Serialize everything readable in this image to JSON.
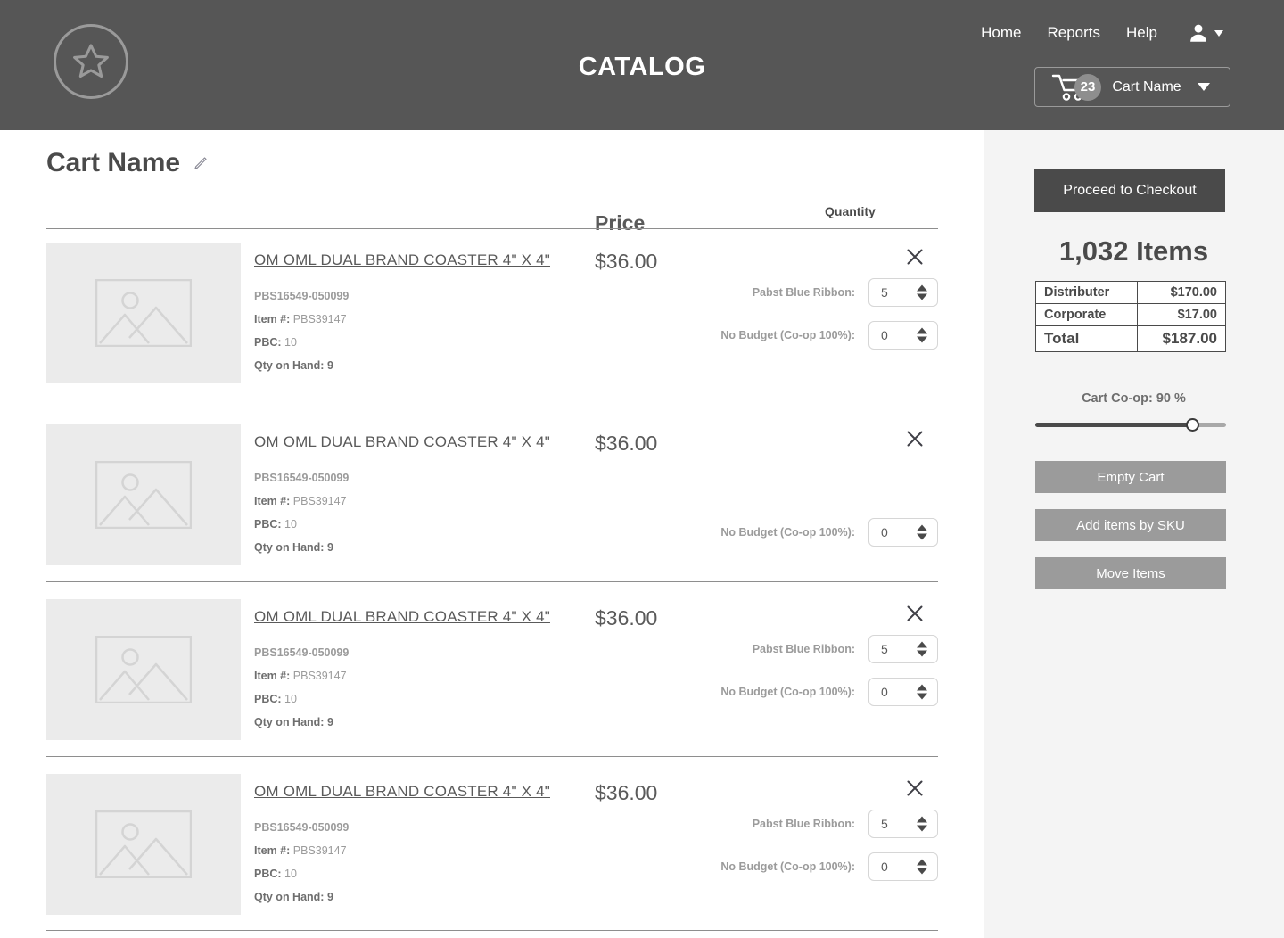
{
  "header": {
    "logo_icon": "star-in-circle-icon",
    "title": "CATALOG",
    "nav": [
      {
        "label": "Home"
      },
      {
        "label": "Reports"
      },
      {
        "label": "Help"
      }
    ],
    "user_icon": "user-account-icon",
    "user_caret_icon": "chevron-down-icon",
    "cart": {
      "cart_icon": "shopping-cart-icon",
      "badge": "23",
      "label": "Cart Name",
      "caret_icon": "chevron-down-icon"
    }
  },
  "main": {
    "cart_name": "Cart Name",
    "edit_icon": "pencil-edit-icon",
    "columns": {
      "price": "Price",
      "quantity": "Quantity"
    },
    "rows": [
      {
        "thumb_icon": "image-placeholder-icon",
        "title": "OM OML DUAL BRAND COASTER 4\" X 4\"",
        "sku": "PBS16549-050099",
        "item_label": "Item #:",
        "item_value": "PBS39147",
        "pbc_label": "PBC:",
        "pbc_value": "10",
        "qty_label": "Qty on Hand:",
        "qty_value": "9",
        "price": "$36.00",
        "remove_icon": "close-x-icon",
        "budgets": [
          {
            "label": "Pabst Blue Ribbon:",
            "value": "5"
          },
          {
            "label": "No Budget (Co-op 100%):",
            "value": "0"
          }
        ]
      },
      {
        "thumb_icon": "image-placeholder-icon",
        "title": "OM OML DUAL BRAND COASTER 4\" X 4\"",
        "sku": "PBS16549-050099",
        "item_label": "Item #:",
        "item_value": "PBS39147",
        "pbc_label": "PBC:",
        "pbc_value": "10",
        "qty_label": "Qty on Hand:",
        "qty_value": "9",
        "price": "$36.00",
        "remove_icon": "close-x-icon",
        "budgets": [
          {
            "label": "No Budget (Co-op 100%):",
            "value": "0"
          }
        ]
      },
      {
        "thumb_icon": "image-placeholder-icon",
        "title": "OM OML DUAL BRAND COASTER 4\" X 4\"",
        "sku": "PBS16549-050099",
        "item_label": "Item #:",
        "item_value": "PBS39147",
        "pbc_label": "PBC:",
        "pbc_value": "10",
        "qty_label": "Qty on Hand:",
        "qty_value": "9",
        "price": "$36.00",
        "remove_icon": "close-x-icon",
        "budgets": [
          {
            "label": "Pabst Blue Ribbon:",
            "value": "5"
          },
          {
            "label": "No Budget (Co-op 100%):",
            "value": "0"
          }
        ]
      },
      {
        "thumb_icon": "image-placeholder-icon",
        "title": "OM OML DUAL BRAND COASTER 4\" X 4\"",
        "sku": "PBS16549-050099",
        "item_label": "Item #:",
        "item_value": "PBS39147",
        "pbc_label": "PBC:",
        "pbc_value": "10",
        "qty_label": "Qty on Hand:",
        "qty_value": "9",
        "price": "$36.00",
        "remove_icon": "close-x-icon",
        "budgets": [
          {
            "label": "Pabst Blue Ribbon:",
            "value": "5"
          },
          {
            "label": "No Budget (Co-op 100%):",
            "value": "0"
          }
        ]
      }
    ]
  },
  "sidebar": {
    "checkout_label": "Proceed to Checkout",
    "items_count": "1,032 Items",
    "totals": [
      {
        "label": "Distributer",
        "value": "$170.00"
      },
      {
        "label": "Corporate",
        "value": "$17.00"
      },
      {
        "label": "Total",
        "value": "$187.00"
      }
    ],
    "coop_label": "Cart Co-op: 90 %",
    "coop_percent": 90,
    "buttons": [
      {
        "label": "Empty Cart"
      },
      {
        "label": "Add items by SKU"
      },
      {
        "label": "Move Items"
      }
    ]
  },
  "colors": {
    "header_bg": "#565656",
    "sidebar_bg": "#f4f4f4",
    "dark_button": "#4a4a4a",
    "gray_button": "#9b9b9b",
    "thumb_bg": "#ebebeb"
  }
}
